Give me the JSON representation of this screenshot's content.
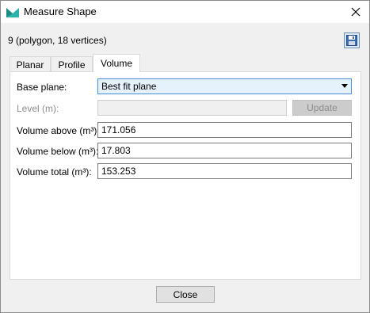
{
  "window": {
    "title": "Measure Shape"
  },
  "shape_info": "9 (polygon, 18 vertices)",
  "tabs": [
    {
      "label": "Planar",
      "active": false
    },
    {
      "label": "Profile",
      "active": false
    },
    {
      "label": "Volume",
      "active": true
    }
  ],
  "volume": {
    "base_plane_label": "Base plane:",
    "base_plane_value": "Best fit plane",
    "level_label": "Level (m):",
    "level_value": "",
    "update_label": "Update",
    "above_label": "Volume above (m³):",
    "above_value": "171.056",
    "below_label": "Volume below (m³):",
    "below_value": "17.803",
    "total_label": "Volume total (m³):",
    "total_value": "153.253"
  },
  "footer": {
    "close_label": "Close"
  },
  "colors": {
    "accent": "#4a8fd6",
    "combo_bg": "#e5f1fb",
    "icon_teal": "#2bb3a8"
  }
}
